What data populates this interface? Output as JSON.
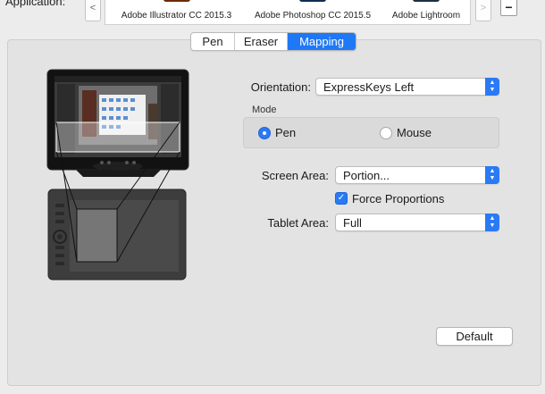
{
  "application": {
    "label": "Application:",
    "scroll_left": "<",
    "scroll_right": ">",
    "remove_button": "−",
    "apps": [
      {
        "name": "Adobe Illustrator CC 2015.3",
        "icon_color": "#e06a1b",
        "selected": false
      },
      {
        "name": "Adobe Photoshop CC 2015.5",
        "icon_color": "#2e9bd8",
        "selected": false
      },
      {
        "name": "Adobe Lightroom",
        "icon_color": "#3d6f9e",
        "selected": true
      }
    ]
  },
  "tabs": [
    {
      "label": "Pen",
      "active": false
    },
    {
      "label": "Eraser",
      "active": false
    },
    {
      "label": "Mapping",
      "active": true
    }
  ],
  "mapping": {
    "orientation_label": "Orientation:",
    "orientation_value": "ExpressKeys Left",
    "mode_label": "Mode",
    "mode_options": [
      {
        "label": "Pen",
        "selected": true
      },
      {
        "label": "Mouse",
        "selected": false
      }
    ],
    "screen_area_label": "Screen Area:",
    "screen_area_value": "Portion...",
    "force_proportions_label": "Force Proportions",
    "force_proportions_checked": true,
    "tablet_area_label": "Tablet Area:",
    "tablet_area_value": "Full",
    "default_button": "Default"
  },
  "colors": {
    "accent": "#1f78f5",
    "panel_background": "#e3e3e3",
    "window_background": "#ececec"
  }
}
